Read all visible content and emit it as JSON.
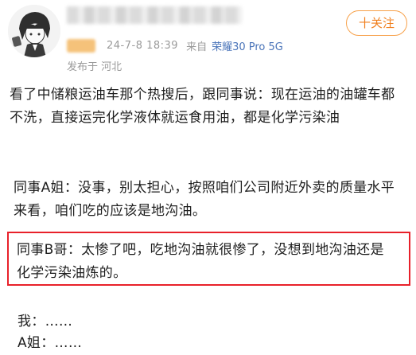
{
  "header": {
    "follow_label": "十关注",
    "timestamp": "24-7-8 18:39",
    "source_prefix": "来自",
    "device": "荣耀30 Pro 5G",
    "location": "发布于 河北"
  },
  "post": {
    "paragraphs": [
      "看了中储粮运油车那个热搜后，跟同事说：现在运油的油罐车都不洗，直接运完化学液体就运食用油，都是化学污染油",
      "同事A姐：没事，别太担心，按照咱们公司附近外卖的质量水平来看，咱们吃的应该是地沟油。",
      "同事B哥：太惨了吧，吃地沟油就很惨了，没想到地沟油还是化学污染油炼的。",
      "我：……",
      "A姐：……"
    ]
  },
  "colors": {
    "accent_orange": "#f08020",
    "highlight_red": "#e8212a",
    "device_blue": "#4a74b9"
  }
}
